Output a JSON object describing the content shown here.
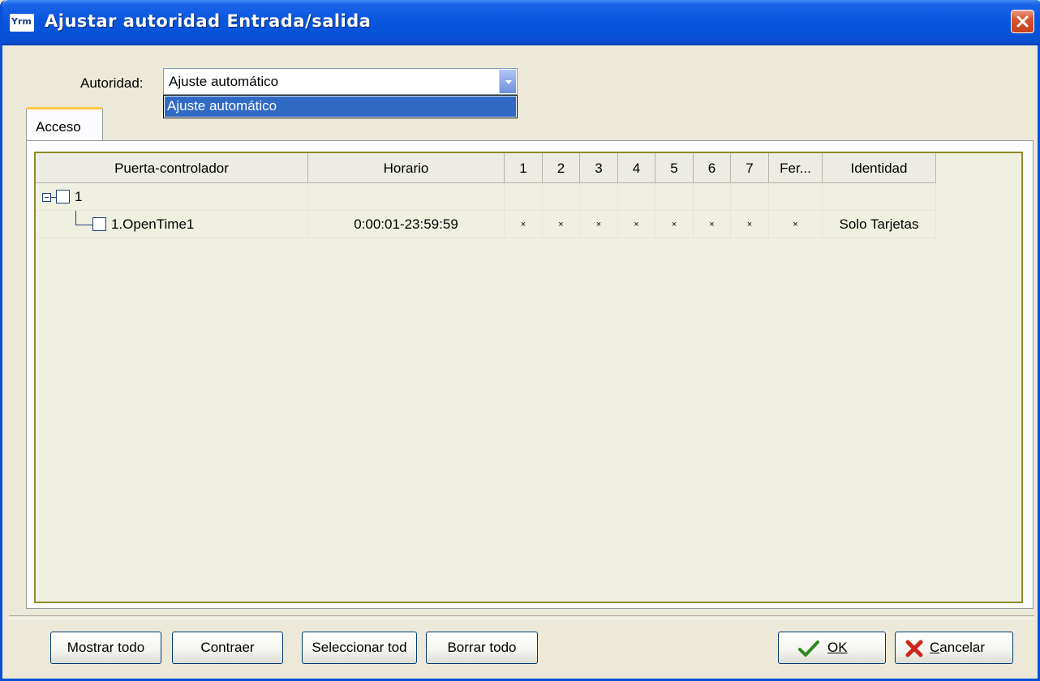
{
  "window": {
    "title": "Ajustar autoridad Entrada/salida",
    "icon_text": "Yrm"
  },
  "authority": {
    "label": "Autoridad:",
    "selected": "Ajuste automático",
    "options": [
      "Ajuste automático"
    ]
  },
  "tabs": [
    {
      "label": "Acceso"
    }
  ],
  "grid": {
    "columns": [
      "Puerta-controlador",
      "Horario",
      "1",
      "2",
      "3",
      "4",
      "5",
      "6",
      "7",
      "Fer...",
      "Identidad"
    ],
    "rows": [
      {
        "level": 0,
        "expanded": true,
        "name": "1",
        "horario": "",
        "days": [
          "",
          "",
          "",
          "",
          "",
          "",
          ""
        ],
        "fer": "",
        "identidad": ""
      },
      {
        "level": 1,
        "name": "1.OpenTime1",
        "horario": "0:00:01-23:59:59",
        "days": [
          "×",
          "×",
          "×",
          "×",
          "×",
          "×",
          "×"
        ],
        "fer": "×",
        "identidad": "Solo Tarjetas"
      }
    ]
  },
  "buttons": {
    "show_all": "Mostrar todo",
    "collapse": "Contraer",
    "select_all": "Seleccionar tod",
    "clear_all": "Borrar todo",
    "ok": "OK",
    "cancel": "Cancelar"
  },
  "colors": {
    "titlebar": "#0653d8",
    "grid_border": "#8c8b26",
    "grid_bg": "#f0f0e0",
    "selection": "#316ac5"
  }
}
